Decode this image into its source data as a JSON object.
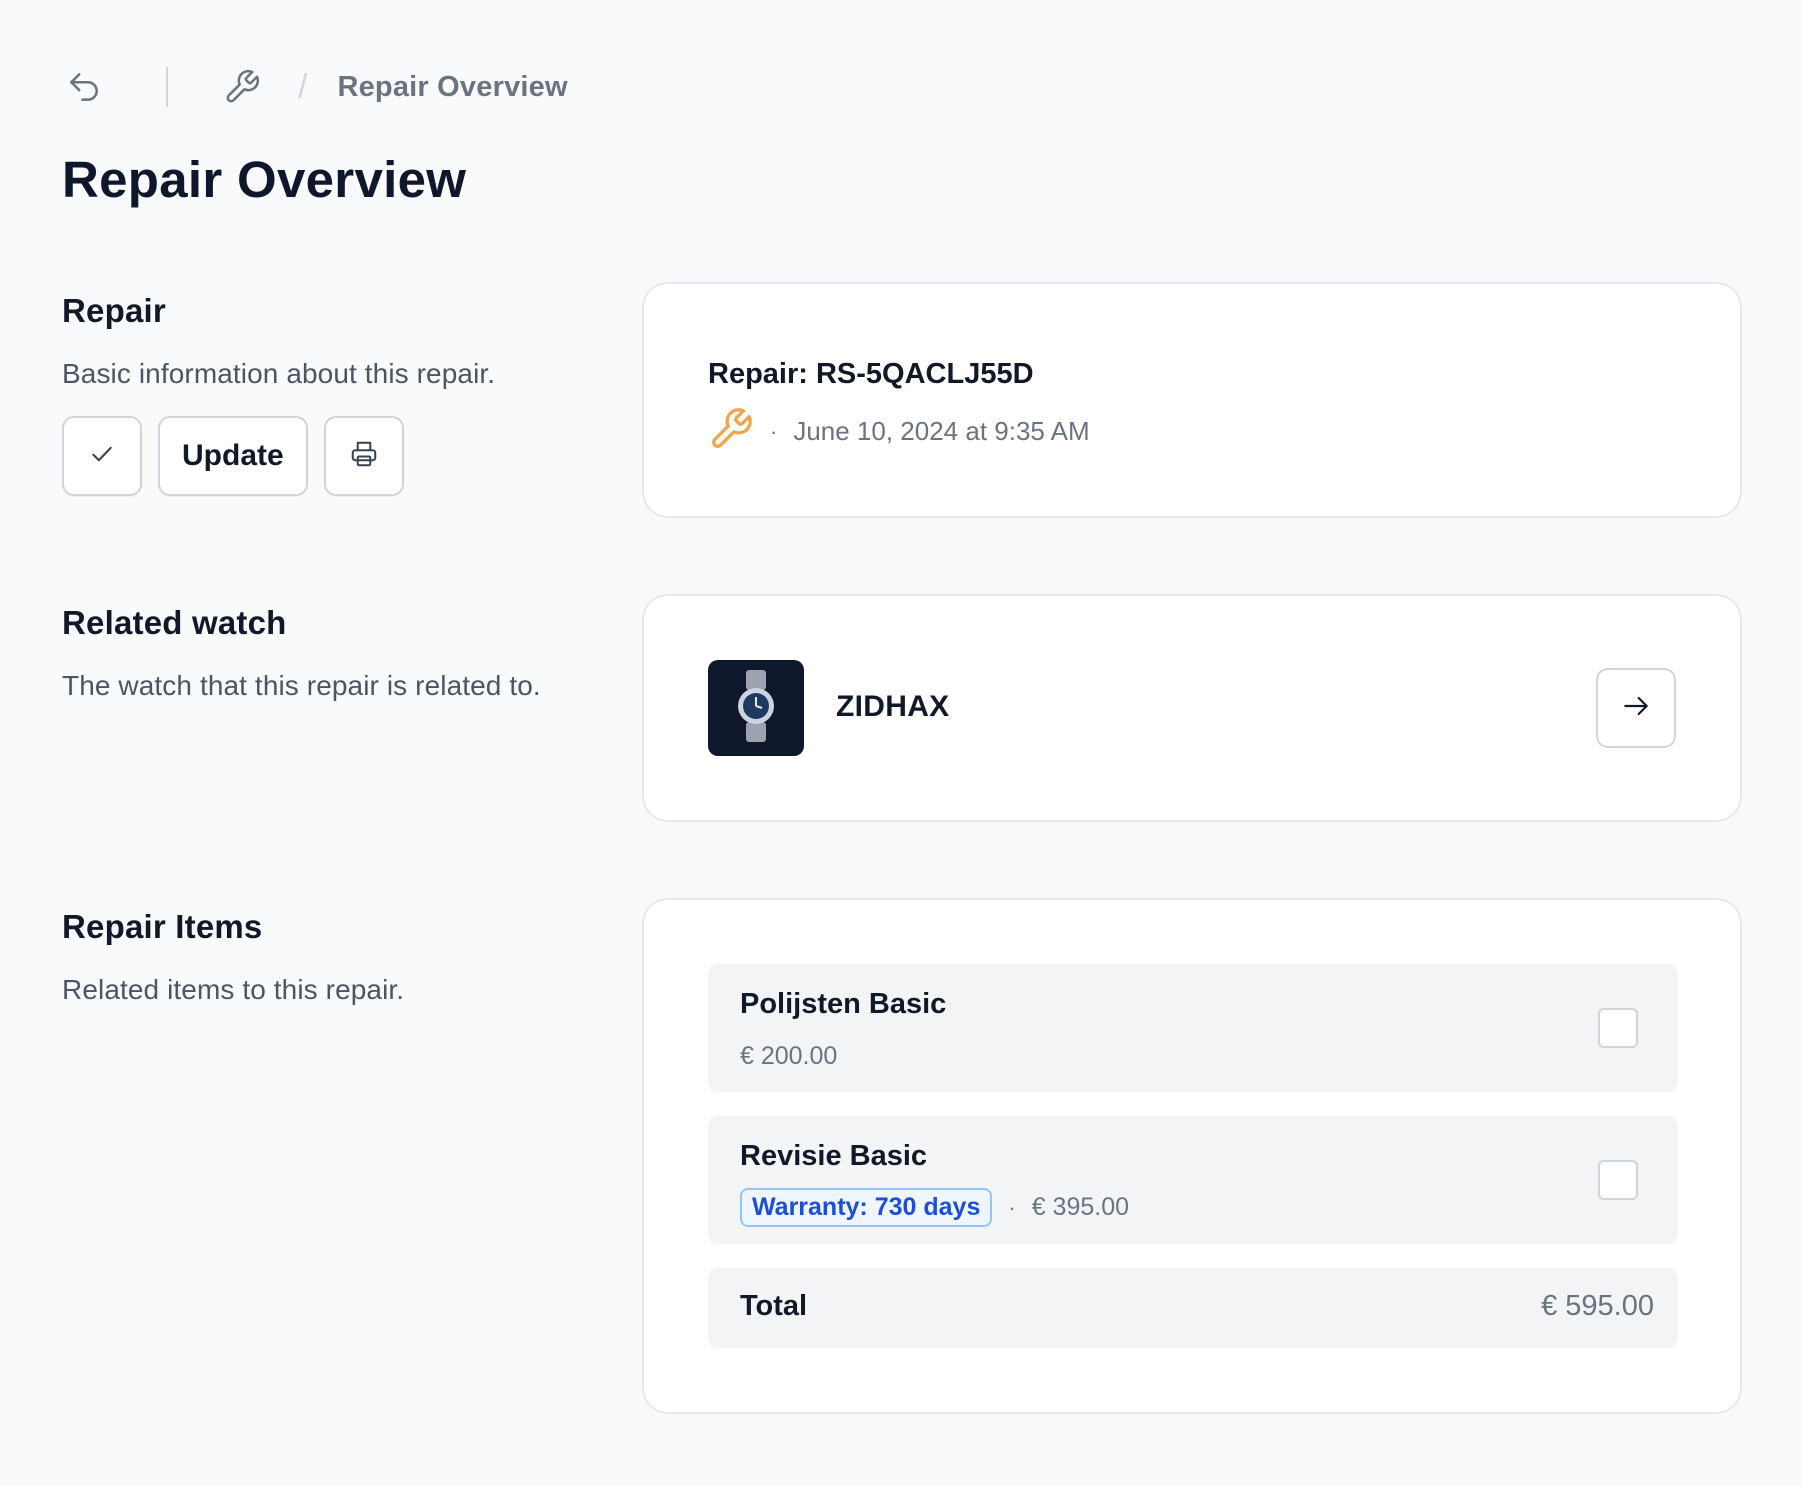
{
  "breadcrumb": {
    "back_icon": "undo-icon",
    "section_icon": "wrench-icon",
    "current": "Repair Overview"
  },
  "page_title": "Repair Overview",
  "repair_section": {
    "heading": "Repair",
    "description": "Basic information about this repair.",
    "buttons": {
      "complete_icon": "check-icon",
      "update_label": "Update",
      "print_icon": "printer-icon"
    }
  },
  "repair_card": {
    "title": "Repair: RS-5QACLJ55D",
    "type_icon": "wrench-icon",
    "type_icon_color": "#f0a44b",
    "separator": "·",
    "date": "June 10, 2024 at 9:35 AM"
  },
  "watch_section": {
    "heading": "Related watch",
    "description": "The watch that this repair is related to."
  },
  "watch_card": {
    "thumbnail_icon": "watch-icon",
    "name": "ZIDHAX",
    "open_icon": "arrow-right-icon"
  },
  "items_section": {
    "heading": "Repair Items",
    "description": "Related items to this repair."
  },
  "items": [
    {
      "name": "Polijsten Basic",
      "price": "€ 200.00",
      "checked": false
    },
    {
      "name": "Revisie Basic",
      "warranty": "Warranty: 730 days",
      "separator": "·",
      "price": "€ 395.00",
      "checked": false
    }
  ],
  "total": {
    "label": "Total",
    "value": "€ 595.00"
  },
  "colors": {
    "background": "#f8fafc",
    "card": "#ffffff",
    "accent_orange": "#f0a44b",
    "badge_blue": "#1d4ed8"
  }
}
